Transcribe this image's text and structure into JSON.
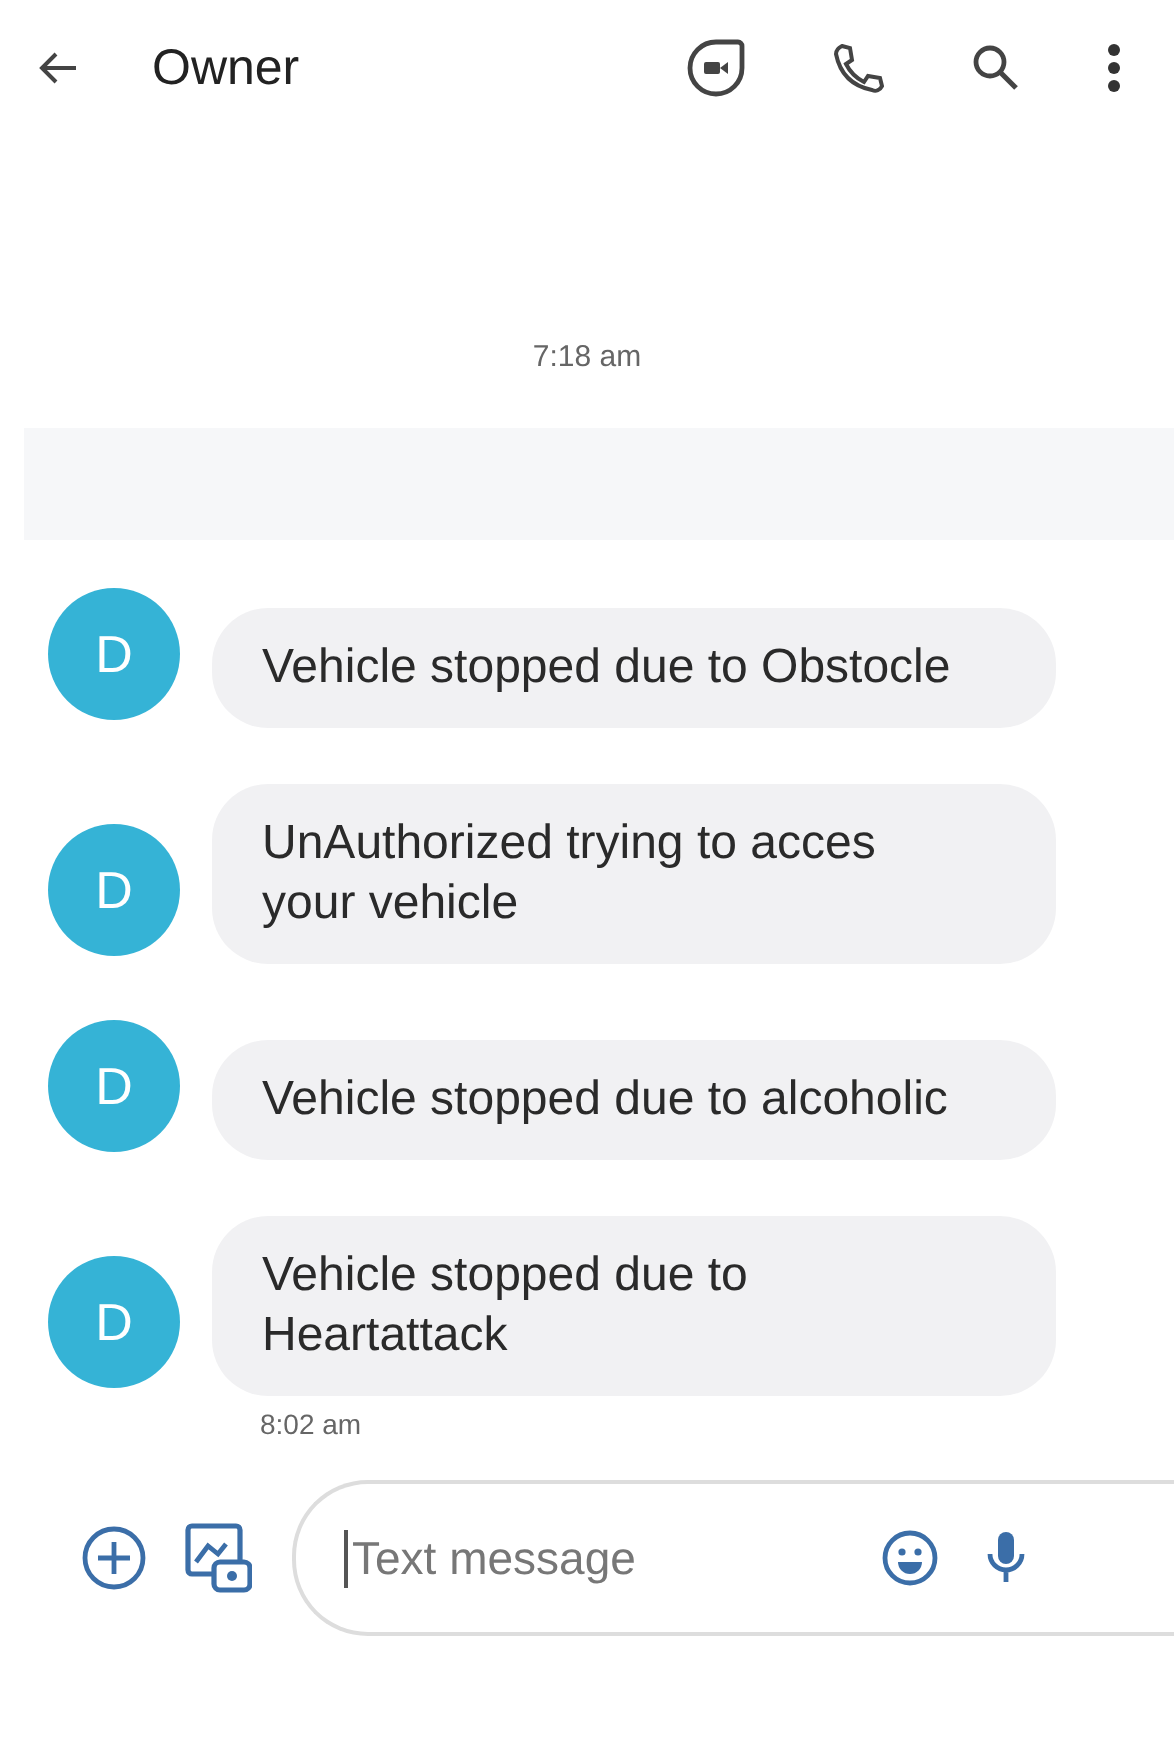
{
  "header": {
    "title": "Owner"
  },
  "timestamp": "7:18 am",
  "messages": [
    {
      "avatar": "D",
      "text": "Vehicle stopped due to Obstocle"
    },
    {
      "avatar": "D",
      "text": "UnAuthorized trying to acces your vehicle"
    },
    {
      "avatar": "D",
      "text": "Vehicle stopped due to alcoholic"
    },
    {
      "avatar": "D",
      "text": "Vehicle stopped due to Heartattack"
    }
  ],
  "last_time": "8:02 am",
  "composer": {
    "placeholder": "Text message"
  }
}
